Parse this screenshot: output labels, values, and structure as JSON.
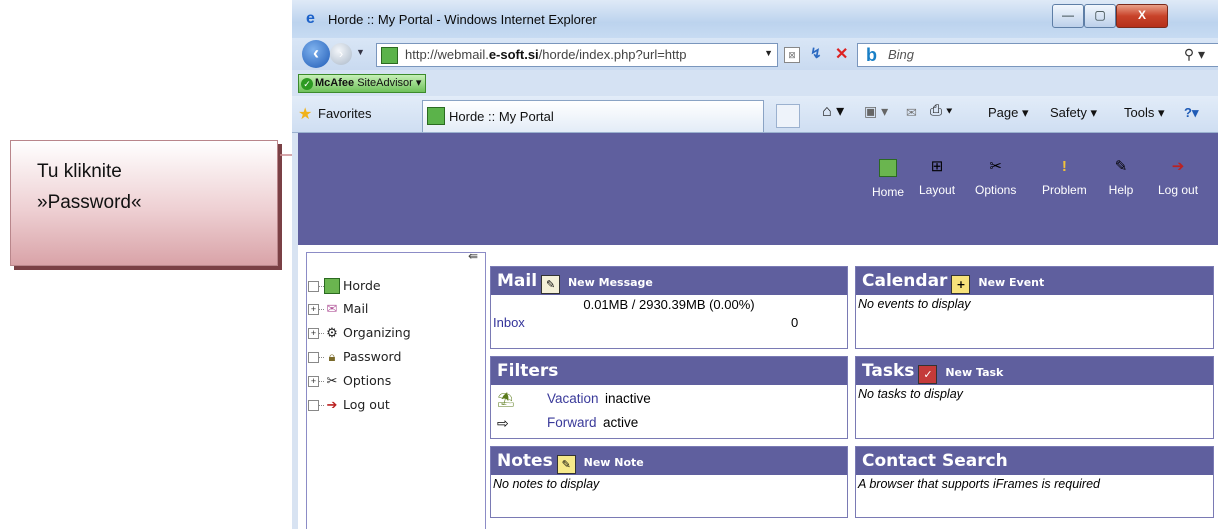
{
  "callout": {
    "text": "Tu kliknite\n»Password«"
  },
  "window": {
    "title": "Horde :: My Portal - Windows Internet Explorer",
    "controls": {
      "minimize": "—",
      "maximize": "▢",
      "close": "X"
    }
  },
  "address": {
    "url_prefix": "http://webmail.",
    "url_domain": "e-soft.si",
    "url_suffix": "/horde/index.php?url=http"
  },
  "search": {
    "placeholder": "Bing",
    "logo": "b"
  },
  "addons": {
    "mcafee_brand": "McAfee",
    "mcafee_label": "SiteAdvisor ▾"
  },
  "favorites": {
    "label": "Favorites"
  },
  "tab": {
    "label": "Horde :: My Portal"
  },
  "commandbar": {
    "page": "Page ▾",
    "safety": "Safety ▾",
    "tools": "Tools ▾",
    "help": "?▾"
  },
  "horde_menu": [
    {
      "label": "Home",
      "icon": "home-icon"
    },
    {
      "label": "Layout",
      "icon": "layout-icon"
    },
    {
      "label": "Options",
      "icon": "options-icon"
    },
    {
      "label": "Problem",
      "icon": "problem-icon"
    },
    {
      "label": "Help",
      "icon": "help-icon"
    },
    {
      "label": "Log out",
      "icon": "logout-icon"
    }
  ],
  "sidebar": {
    "items": [
      {
        "label": "Horde",
        "icon": "horde-icon",
        "expander": ""
      },
      {
        "label": "Mail",
        "icon": "mail-icon",
        "expander": "+"
      },
      {
        "label": "Organizing",
        "icon": "organizing-icon",
        "expander": "+"
      },
      {
        "label": "Password",
        "icon": "lock-icon",
        "expander": ""
      },
      {
        "label": "Options",
        "icon": "options-icon",
        "expander": "+"
      },
      {
        "label": "Log out",
        "icon": "logout-icon",
        "expander": ""
      }
    ]
  },
  "blocks": {
    "mail": {
      "title": "Mail",
      "action": "New Message",
      "quota": "0.01MB / 2930.39MB (0.00%)",
      "inbox_label": "Inbox",
      "inbox_count": "0"
    },
    "calendar": {
      "title": "Calendar",
      "action": "New Event",
      "empty": "No events to display"
    },
    "filters": {
      "title": "Filters",
      "rows": [
        {
          "name": "Vacation",
          "state": "inactive"
        },
        {
          "name": "Forward",
          "state": "active"
        }
      ]
    },
    "tasks": {
      "title": "Tasks",
      "action": "New Task",
      "empty": "No tasks to display"
    },
    "notes": {
      "title": "Notes",
      "action": "New Note",
      "empty": "No notes to display"
    },
    "contacts": {
      "title": "Contact Search",
      "empty": "A browser that supports iFrames is required"
    }
  }
}
